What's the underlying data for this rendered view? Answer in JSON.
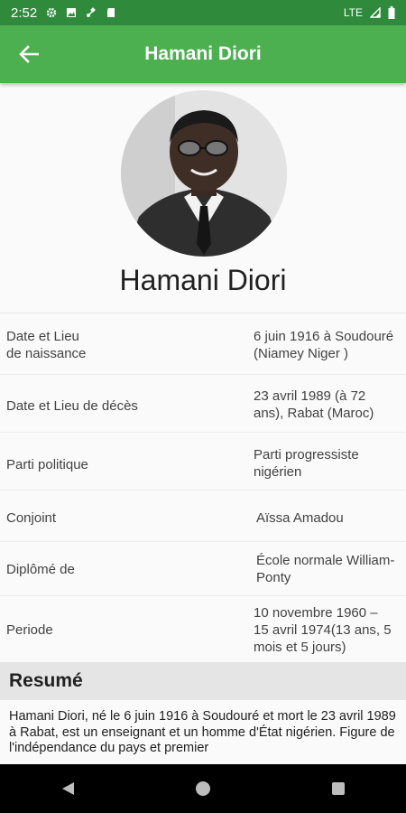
{
  "status_bar": {
    "time": "2:52",
    "network": "LTE"
  },
  "app_bar": {
    "title": "Hamani Diori"
  },
  "profile": {
    "name": "Hamani Diori"
  },
  "details": [
    {
      "label": "Date et Lieu\nde naissance",
      "value": "6 juin 1916 à Soudouré\n(Niamey Niger )"
    },
    {
      "label": "Date et Lieu de décès",
      "value": "23 avril 1989 (à 72\nans), Rabat (Maroc)"
    },
    {
      "label": "Parti politique",
      "value": "Parti progressiste\nnigérien"
    },
    {
      "label": "Conjoint",
      "value": "Aïssa Amadou"
    },
    {
      "label": "Diplômé de",
      "value": "École normale William-\nPonty"
    },
    {
      "label": "Periode",
      "value": "10 novembre 1960 –\n15 avril 1974(13 ans, 5\nmois et 5 jours)"
    }
  ],
  "resume": {
    "title": "Resumé",
    "text": "Hamani Diori, né le 6 juin 1916 à Soudouré et mort le 23 avril 1989 à Rabat, est un enseignant et un homme d'État nigérien. Figure de l'indépendance du pays et premier"
  },
  "colors": {
    "app_bar": "#4caf50",
    "status_bar": "#2f8a3c",
    "nav_bar": "#000000"
  },
  "icons": {
    "status": [
      "gear-icon",
      "image-icon",
      "satellite-icon",
      "sd-card-icon",
      "signal-icon",
      "battery-icon"
    ],
    "nav": [
      "back-triangle-icon",
      "home-circle-icon",
      "recents-square-icon"
    ]
  }
}
